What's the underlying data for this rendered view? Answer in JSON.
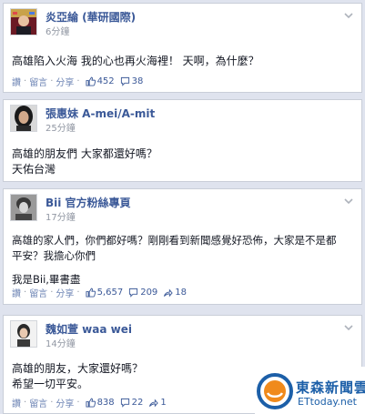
{
  "posts": [
    {
      "name": "炎亞綸 (華研國際)",
      "time": "6分鐘",
      "lines": [
        "高雄陷入火海 我的心也再火海裡！ 天啊，為什麼？"
      ],
      "actions": {
        "like": "讚",
        "comment": "留言",
        "share": "分享"
      },
      "likes": "452",
      "comments": "38"
    },
    {
      "name": "張惠妹 A-mei/A-mit",
      "time": "25分鐘",
      "lines": [
        "高雄的朋友們 大家都還好嗎？",
        "天佑台灣"
      ]
    },
    {
      "name": "Bii 官方粉絲專頁",
      "time": "17分鐘",
      "lines": [
        "高雄的家人們，你們都好嗎？剛剛看到新聞感覺好恐佈，大家是不是都",
        "平安？我擔心你們"
      ],
      "signature": "我是Bii,畢書盡",
      "actions": {
        "like": "讚",
        "comment": "留言",
        "share": "分享"
      },
      "likes": "5,657",
      "comments": "209",
      "shares": "18"
    },
    {
      "name": "魏如萱 waa wei",
      "time": "14分鐘",
      "lines": [
        "高雄的朋友，大家還好嗎？",
        "希望一切平安。"
      ],
      "actions": {
        "like": "讚",
        "comment": "留言",
        "share": "分享"
      },
      "likes": "838",
      "comments": "22",
      "shares": "1"
    }
  ],
  "watermark": {
    "name_zh": "東森新聞雲",
    "name_en": "ETtoday.net"
  },
  "colors": {
    "link": "#3b5998",
    "meta": "#9197a3",
    "brand": "#1c5fa8"
  }
}
